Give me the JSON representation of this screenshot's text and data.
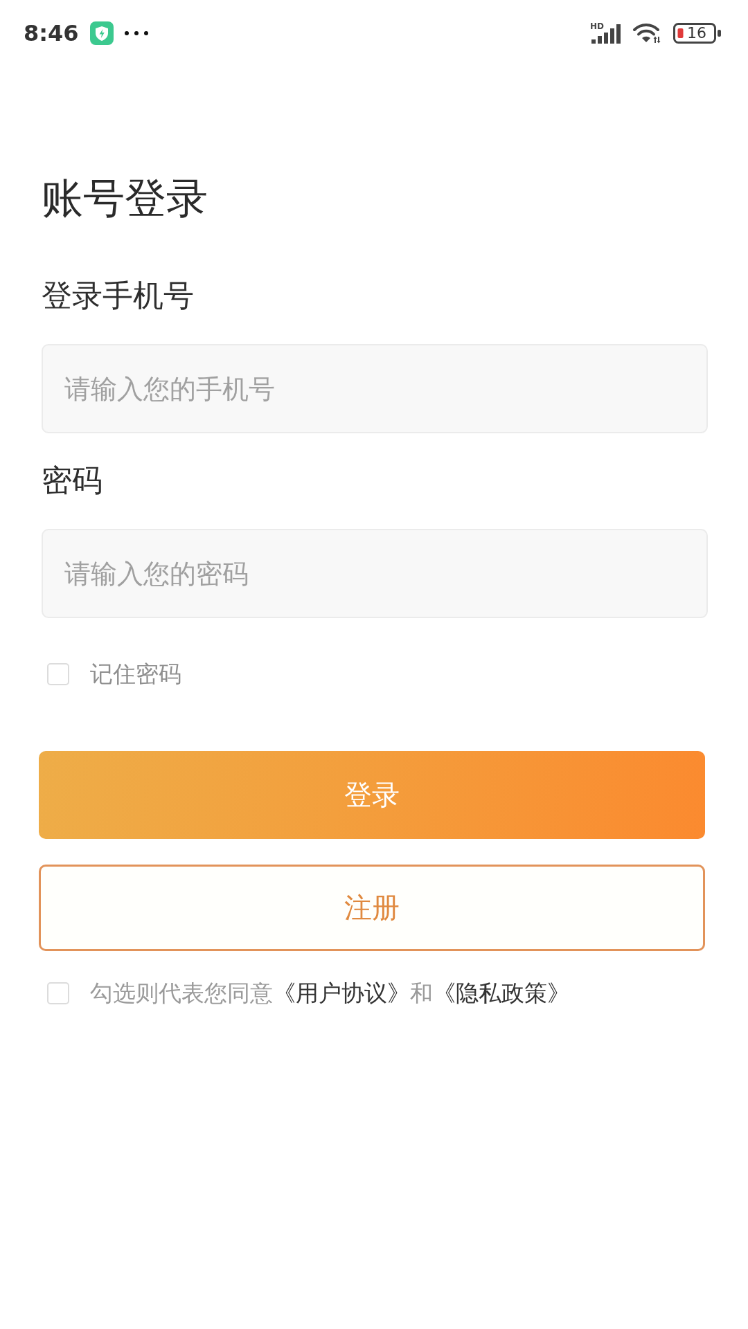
{
  "status_bar": {
    "time": "8:46",
    "network_type": "HD",
    "battery": "16"
  },
  "title": "账号登录",
  "fields": [
    {
      "label": "登录手机号",
      "placeholder": "请输入您的手机号"
    },
    {
      "label": "密码",
      "placeholder": "请输入您的密码"
    }
  ],
  "remember": {
    "label": "记住密码",
    "checked": false
  },
  "buttons": [
    {
      "label": "登录",
      "kind": "primary"
    },
    {
      "label": "注册",
      "kind": "outline"
    }
  ],
  "agreement": {
    "checked": false,
    "parts": [
      {
        "text": "勾选则代表您同意",
        "kind": "plain"
      },
      {
        "text": "《用户协议》",
        "kind": "link"
      },
      {
        "text": "和",
        "kind": "plain"
      },
      {
        "text": "《隐私政策》",
        "kind": "link"
      }
    ]
  }
}
